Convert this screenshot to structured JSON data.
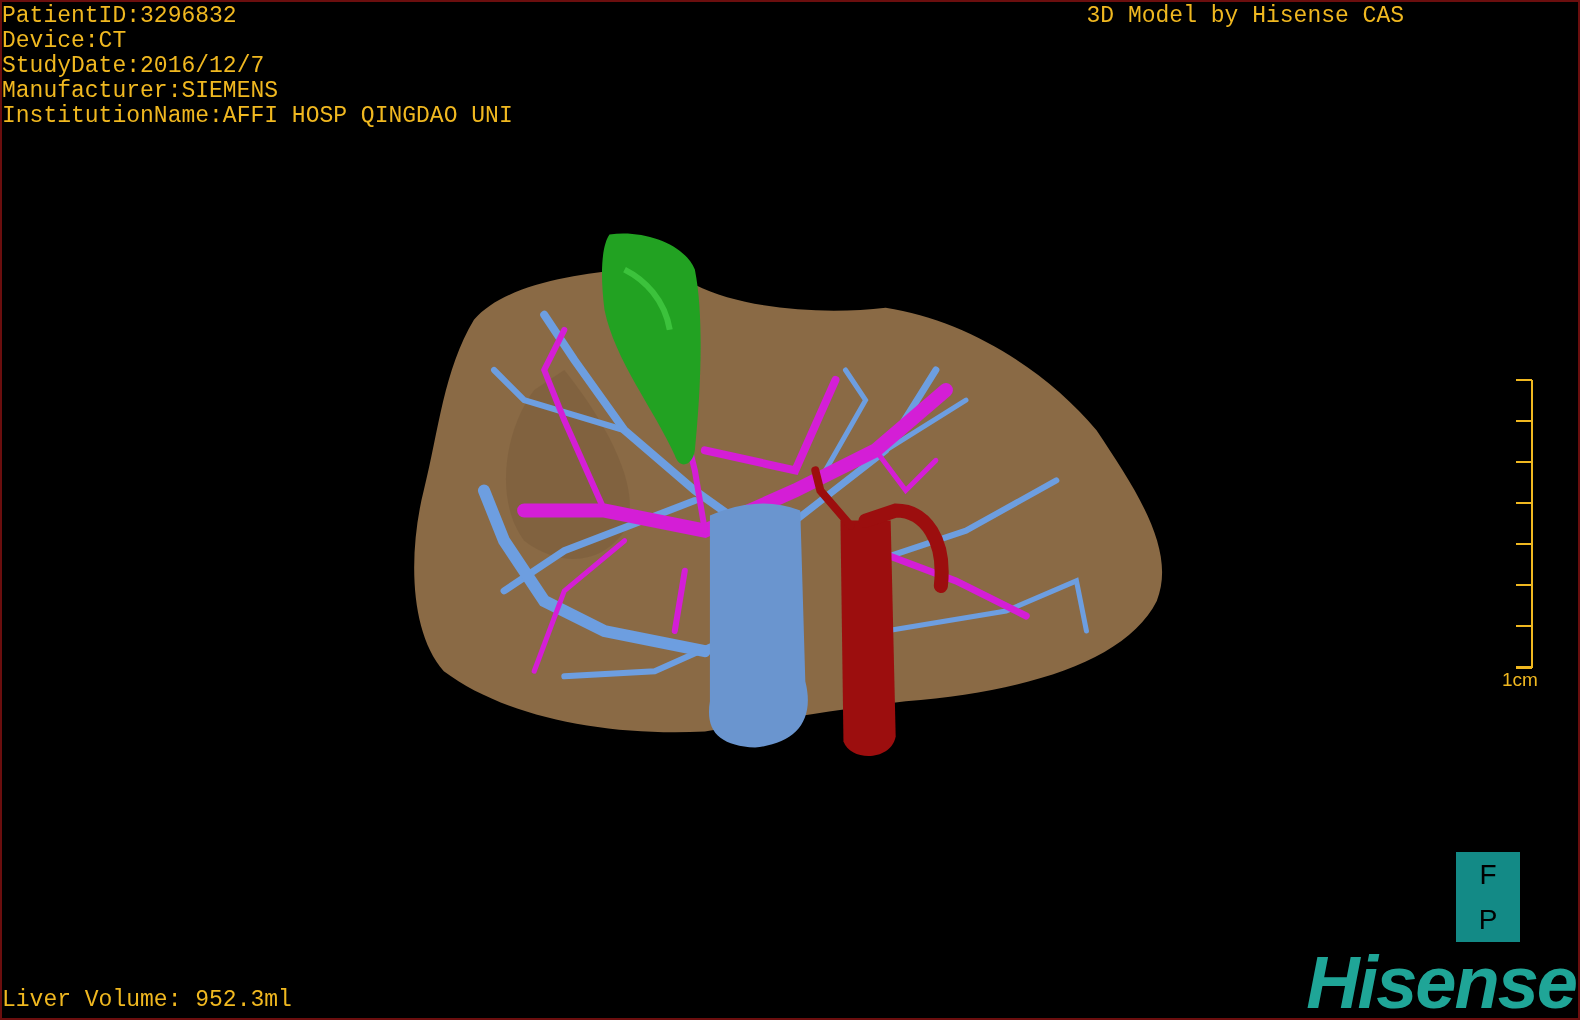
{
  "patient_info": [
    "PatientID:3296832",
    "Device:CT",
    "StudyDate:2016/12/7",
    "Manufacturer:SIEMENS",
    "InstitutionName:AFFI HOSP QINGDAO UNI"
  ],
  "title": "3D Model by Hisense CAS",
  "scale_bar": {
    "label": "1cm"
  },
  "liver_volume": "Liver Volume: 952.3ml",
  "orientation_marker": {
    "top": "F",
    "bottom": "P"
  },
  "logo": "Hisense"
}
